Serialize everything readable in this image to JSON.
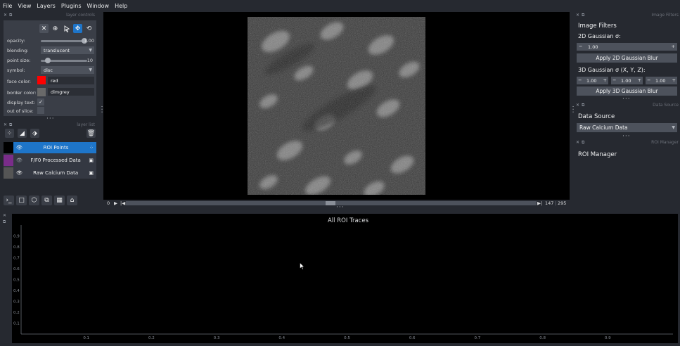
{
  "menu": [
    "File",
    "View",
    "Layers",
    "Plugins",
    "Window",
    "Help"
  ],
  "layer_controls": {
    "title": "layer controls",
    "opacity_label": "opacity:",
    "opacity_value": "1.00",
    "opacity_fraction": 1.0,
    "blending_label": "blending:",
    "blending_value": "translucent",
    "point_size_label": "point size:",
    "point_size_value": "10",
    "point_size_fraction": 0.1,
    "symbol_label": "symbol:",
    "symbol_value": "disc",
    "face_color_label": "face color:",
    "face_color_value": "red",
    "face_color_hex": "#ff0000",
    "border_color_label": "border color:",
    "border_color_value": "dimgrey",
    "border_color_hex": "#696969",
    "display_text_label": "display text:",
    "display_text_checked": true,
    "out_of_slice_label": "out of slice:",
    "out_of_slice_checked": false,
    "check_glyph": "✓"
  },
  "layer_list": {
    "title": "layer list",
    "layers": [
      {
        "name": "ROI Points",
        "selected": true
      },
      {
        "name": "F/F0 Processed Data",
        "selected": false
      },
      {
        "name": "Raw Calcium Data",
        "selected": false
      }
    ]
  },
  "dims": {
    "frame_index": "0",
    "current": "147",
    "total": "295",
    "separator": "|"
  },
  "image_filters": {
    "dock_title": "Image Filters",
    "heading": "Image Filters",
    "gauss2d_label": "2D Gaussian σ:",
    "gauss2d_value": "1.00",
    "apply2d_label": "Apply 2D Gaussian Blur",
    "gauss3d_label": "3D Gaussian σ (X, Y, Z):",
    "gauss3d_values": [
      "1.00",
      "1.00",
      "1.00"
    ],
    "apply3d_label": "Apply 3D Gaussian Blur",
    "minus": "−",
    "plus": "+"
  },
  "data_source": {
    "dock_title": "Data Source",
    "heading": "Data Source",
    "value": "Raw Calcium Data"
  },
  "roi_manager": {
    "dock_title": "ROI Manager",
    "heading": "ROI Manager"
  },
  "chart_data": {
    "type": "line",
    "title": "All ROI Traces",
    "xlabel": "",
    "ylabel": "",
    "xlim": [
      0,
      1
    ],
    "ylim": [
      0,
      1
    ],
    "x_ticks": [
      "0.1",
      "0.2",
      "0.3",
      "0.4",
      "0.5",
      "0.6",
      "0.7",
      "0.8",
      "0.9"
    ],
    "y_ticks": [
      "0.9",
      "0.8",
      "0.7",
      "0.6",
      "0.5",
      "0.4",
      "0.3",
      "0.2",
      "0.1"
    ],
    "series": [],
    "grid": false
  },
  "colors": {
    "accent": "#1e75c9",
    "panel": "#3a3e47",
    "background": "#262930"
  }
}
